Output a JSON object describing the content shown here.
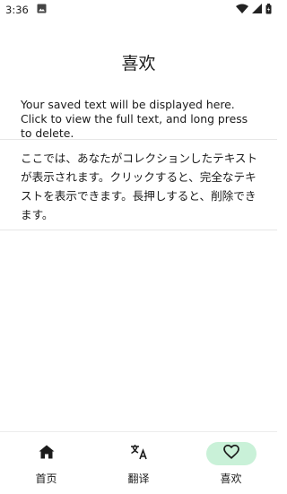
{
  "status_bar": {
    "time": "3:36"
  },
  "header": {
    "title": "喜欢"
  },
  "main": {
    "hint": "Your saved text will be displayed here. Click to view the full text, and long press to delete.",
    "saved_items": [
      "ここでは、あなたがコレクションしたテキストが表示されます。クリックすると、完全なテキストを表示できます。長押しすると、削除できます。"
    ]
  },
  "bottom_nav": {
    "items": [
      {
        "label": "首页",
        "icon": "home-icon"
      },
      {
        "label": "翻译",
        "icon": "translate-icon"
      },
      {
        "label": "喜欢",
        "icon": "heart-outline-icon",
        "active": true
      }
    ]
  },
  "colors": {
    "active_pill": "#c9f1d8",
    "divider": "#e6e6e6",
    "text": "#1b1b1b"
  }
}
